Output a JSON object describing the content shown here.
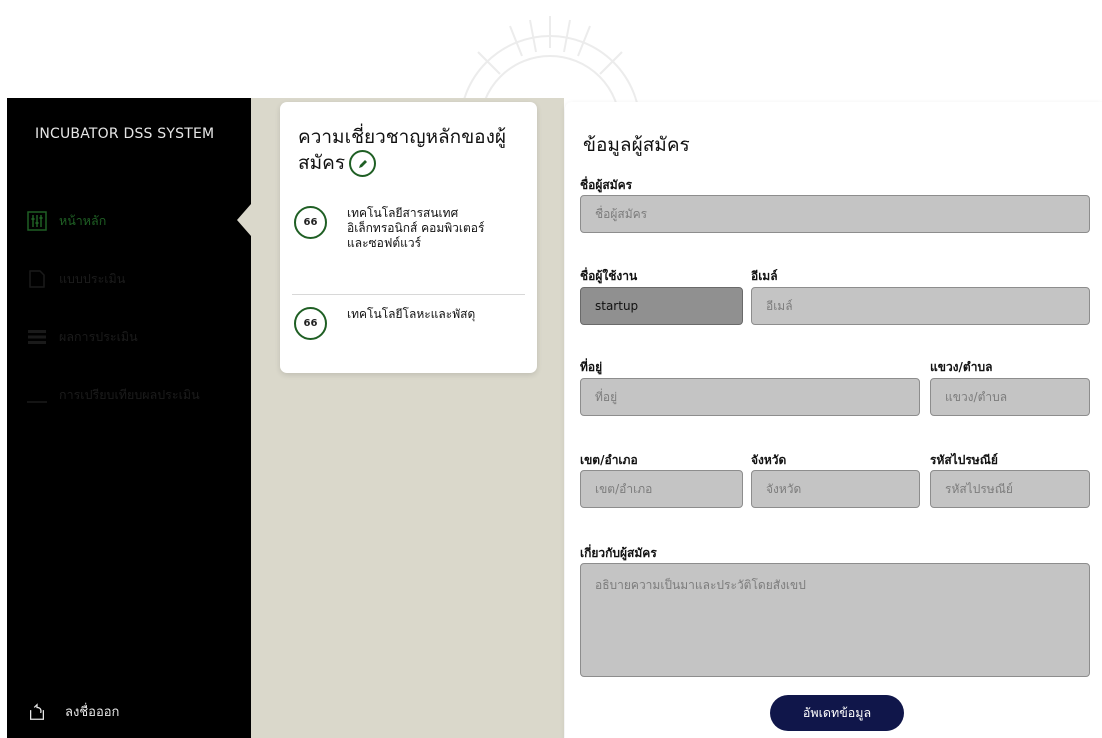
{
  "sidebar": {
    "brand": "INCUBATOR DSS SYSTEM",
    "items": [
      {
        "label": "หน้าหลัก",
        "icon": "sliders-icon",
        "active": true
      },
      {
        "label": "แบบประเมิน",
        "icon": "document-icon",
        "active": false
      },
      {
        "label": "ผลการประเมิน",
        "icon": "list-icon",
        "active": false
      },
      {
        "label": "การเปรียบเทียบผลประเมิน",
        "icon": "compare-icon",
        "active": false
      }
    ],
    "logout_label": "ลงชื่อออก",
    "logout_icon": "logout-icon"
  },
  "expertise": {
    "title": "ความเชี่ยวชาญหลักของผู้สมัคร",
    "items": [
      {
        "score": "66",
        "text": "เทคโนโลยีสารสนเทศ อิเล็กทรอนิกส์ คอมพิวเตอร์และซอฟต์แวร์"
      },
      {
        "score": "66",
        "text": "เทคโนโลยีโลหะและพัสดุ"
      }
    ]
  },
  "form": {
    "title": "ข้อมูลผู้สมัคร",
    "applicant_name": {
      "label": "ชื่อผู้สมัคร",
      "placeholder": "ชื่อผู้สมัคร",
      "value": ""
    },
    "username": {
      "label": "ชื่อผู้ใช้งาน",
      "value": "startup"
    },
    "email": {
      "label": "อีเมล์",
      "placeholder": "อีเมล์",
      "value": ""
    },
    "address": {
      "label": "ที่อยู่",
      "placeholder": "ที่อยู่",
      "value": ""
    },
    "subdistrict": {
      "label": "แขวง/ตำบล",
      "placeholder": "แขวง/ตำบล",
      "value": ""
    },
    "district": {
      "label": "เขต/อำเภอ",
      "placeholder": "เขต/อำเภอ",
      "value": ""
    },
    "province": {
      "label": "จังหวัด",
      "placeholder": "จังหวัด",
      "value": ""
    },
    "postal_code": {
      "label": "รหัสไปรษณีย์",
      "placeholder": "รหัสไปรษณีย์",
      "value": ""
    },
    "about": {
      "label": "เกี่ยวกับผู้สมัคร",
      "placeholder": "อธิบายความเป็นมาและประวัติโดยสังเขป",
      "value": ""
    },
    "submit_label": "อัพเดทข้อมูล"
  },
  "colors": {
    "sidebar_bg": "#000000",
    "middle_bg": "#dad8cb",
    "accent_green": "#1f5f24",
    "button_navy": "#10164a",
    "input_bg": "#c4c4c4",
    "input_filled_bg": "#909090"
  }
}
